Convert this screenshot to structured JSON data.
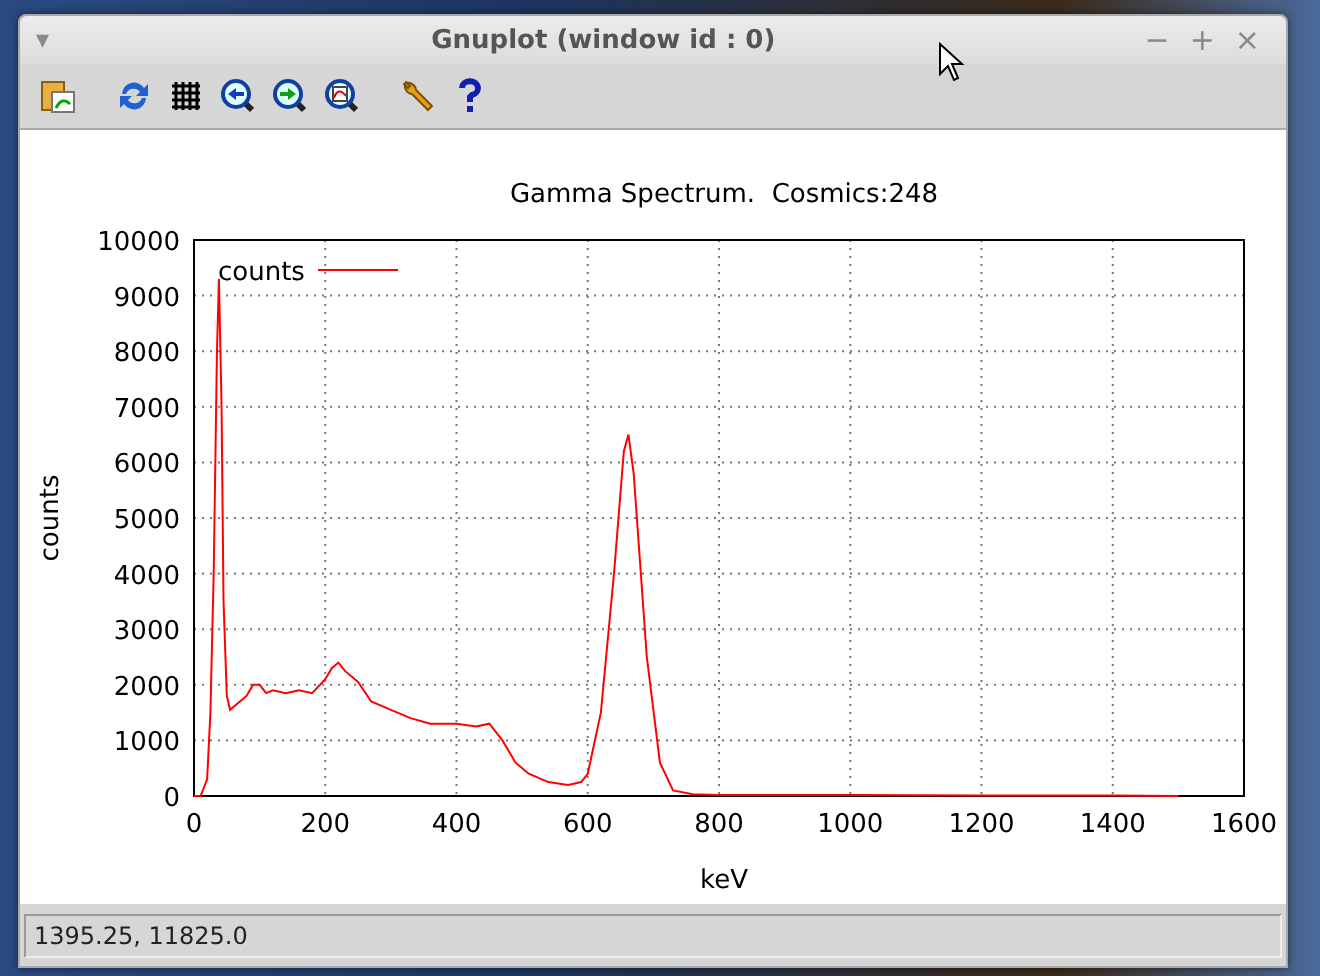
{
  "window": {
    "title": "Gnuplot (window id : 0)",
    "menu_glyph": "▾",
    "controls": [
      "−",
      "+",
      "×"
    ]
  },
  "toolbar": {
    "tools": [
      {
        "kind": "copy"
      },
      {
        "kind": "replot"
      },
      {
        "kind": "grid"
      },
      {
        "kind": "previous-zoom"
      },
      {
        "kind": "next-zoom"
      },
      {
        "kind": "autoscale"
      },
      {
        "kind": "options"
      },
      {
        "kind": "help"
      }
    ]
  },
  "plot": {
    "chart_data": {
      "type": "line",
      "grid": true,
      "title": "Gamma Spectrum.  Cosmics:248",
      "xlabel": "keV",
      "ylabel": "counts",
      "xlim": [
        0,
        1600
      ],
      "ylim": [
        0,
        10000
      ],
      "xticks": [
        0,
        200,
        400,
        600,
        800,
        1000,
        1200,
        1400,
        1600
      ],
      "yticks": [
        0,
        1000,
        2000,
        3000,
        4000,
        5000,
        6000,
        7000,
        8000,
        9000,
        10000
      ],
      "x": [
        0,
        10,
        20,
        25,
        30,
        35,
        38,
        42,
        45,
        50,
        55,
        60,
        70,
        80,
        90,
        100,
        110,
        120,
        140,
        160,
        180,
        200,
        210,
        220,
        230,
        250,
        270,
        300,
        330,
        360,
        400,
        430,
        450,
        470,
        490,
        510,
        540,
        570,
        590,
        600,
        620,
        640,
        655,
        662,
        670,
        690,
        710,
        730,
        760,
        800,
        1000,
        1200,
        1400,
        1500
      ],
      "series": [
        {
          "name": "counts",
          "color": "#ff0000",
          "values": [
            0,
            0,
            300,
            1500,
            4000,
            8000,
            9300,
            7000,
            3500,
            1800,
            1550,
            1600,
            1700,
            1800,
            2000,
            2000,
            1850,
            1900,
            1850,
            1900,
            1850,
            2100,
            2300,
            2400,
            2250,
            2050,
            1700,
            1550,
            1400,
            1300,
            1300,
            1250,
            1300,
            1000,
            600,
            400,
            250,
            200,
            250,
            400,
            1500,
            4000,
            6200,
            6500,
            5800,
            2500,
            600,
            100,
            30,
            20,
            20,
            10,
            10,
            0
          ]
        }
      ]
    }
  },
  "status_bar": {
    "text": "1395.25,  11825.0"
  }
}
